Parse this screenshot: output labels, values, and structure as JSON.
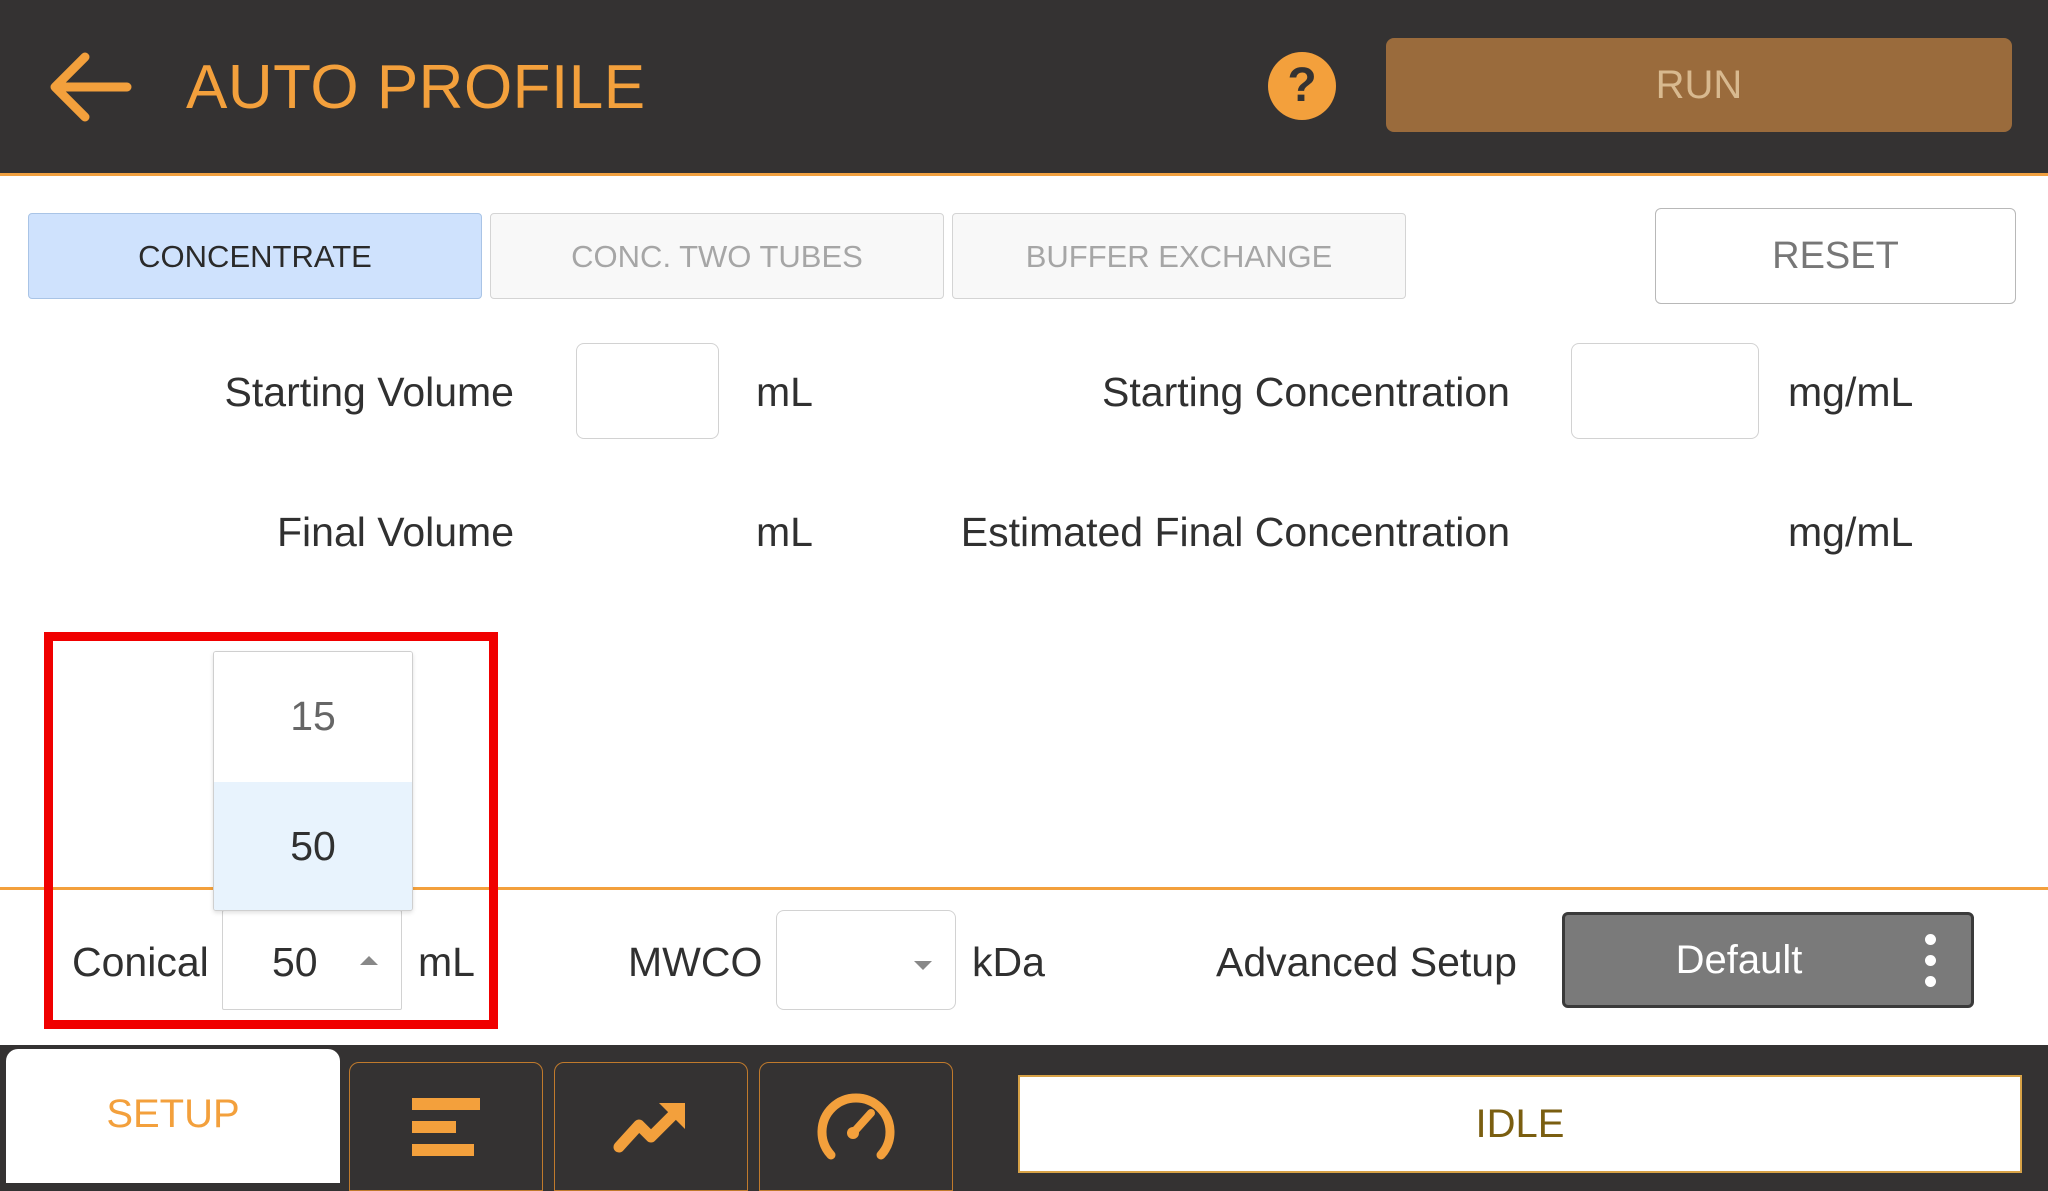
{
  "header": {
    "title": "AUTO PROFILE",
    "help_icon": "?",
    "run_label": "RUN",
    "colors": {
      "background": "#343232",
      "accent": "#f3a03c",
      "run_button": "#9a6b3c"
    }
  },
  "mode_tabs": [
    {
      "label": "CONCENTRATE",
      "active": true
    },
    {
      "label": "CONC. TWO TUBES",
      "active": false
    },
    {
      "label": "BUFFER EXCHANGE",
      "active": false
    }
  ],
  "reset_label": "RESET",
  "form": {
    "starting_volume": {
      "label": "Starting Volume",
      "value": "",
      "unit": "mL"
    },
    "starting_concentration": {
      "label": "Starting Concentration",
      "value": "",
      "unit": "mg/mL"
    },
    "final_volume": {
      "label": "Final Volume",
      "unit": "mL"
    },
    "estimated_final_concentration": {
      "label": "Estimated Final Concentration",
      "unit": "mg/mL"
    }
  },
  "conical_dropdown": {
    "options": [
      "15",
      "50"
    ],
    "selected": "50",
    "highlight_color": "#f00000"
  },
  "settings": {
    "conical": {
      "label": "Conical",
      "value": "50",
      "unit": "mL"
    },
    "mwco": {
      "label": "MWCO",
      "value": "",
      "unit": "kDa"
    },
    "advanced_setup": {
      "label": "Advanced Setup",
      "button_label": "Default"
    }
  },
  "bottom_nav": {
    "setup_label": "SETUP",
    "icons": [
      "list-bars-icon",
      "trend-arrow-icon",
      "gauge-icon"
    ]
  },
  "status": "IDLE"
}
